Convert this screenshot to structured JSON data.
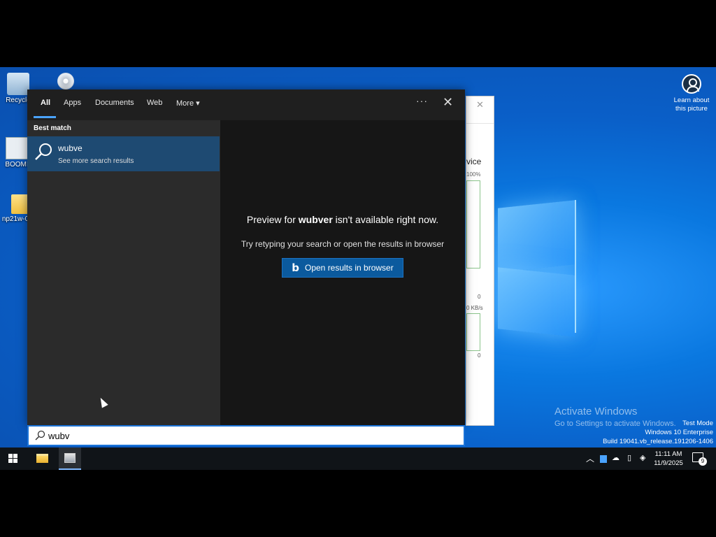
{
  "desktop": {
    "icons": [
      {
        "label": "Recycle"
      },
      {
        "label": ""
      },
      {
        "label": "BOOMI"
      },
      {
        "label": "np21w-0"
      }
    ],
    "learn_picture": "Learn about this picture"
  },
  "background_window": {
    "title_fragment": "vice",
    "percent": "100%",
    "zero1": "0",
    "rate": "0 KB/s",
    "zero2": "0"
  },
  "search_panel": {
    "tabs": [
      {
        "label": "All",
        "active": true
      },
      {
        "label": "Apps"
      },
      {
        "label": "Documents"
      },
      {
        "label": "Web"
      },
      {
        "label": "More"
      }
    ],
    "ellipsis": "···",
    "close": "✕",
    "best_match_label": "Best match",
    "result": {
      "title": "wubve",
      "subtitle": "See more search results"
    },
    "preview": {
      "prefix": "Preview for ",
      "query": "wubver",
      "suffix": " isn't available right now.",
      "retry": "Try retyping your search or open the results in browser",
      "button_label": "Open results in browser",
      "button_icon": "b"
    }
  },
  "search_box": {
    "value": "wubv"
  },
  "watermark": {
    "title": "Activate Windows",
    "subtitle": "Go to Settings to activate Windows.",
    "test_mode": "Test Mode",
    "edition": "Windows 10 Enterprise",
    "build": "Build 19041.vb_release.191206-1406"
  },
  "taskbar": {
    "time": "11:11 AM",
    "date": "11/9/2025",
    "notifications_count": "9"
  },
  "colors": {
    "accent": "#1a73d8",
    "selection": "#1e4a72",
    "button": "#0b5a9e"
  }
}
